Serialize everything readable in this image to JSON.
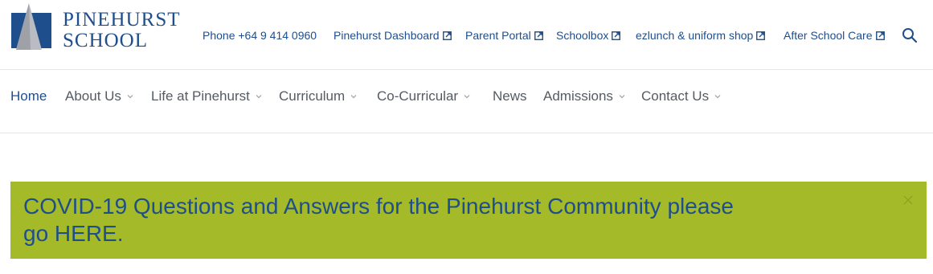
{
  "logo": {
    "line1": "PINEHURST",
    "line2": "SCHOOL"
  },
  "utility_links": [
    {
      "label": "Phone +64 9 414 0960",
      "external": false
    },
    {
      "label": "Pinehurst Dashboard",
      "external": true
    },
    {
      "label": "Parent Portal",
      "external": true
    },
    {
      "label": "Schoolbox",
      "external": true
    },
    {
      "label": "ezlunch & uniform shop",
      "external": true
    },
    {
      "label": "After School Care",
      "external": true
    }
  ],
  "nav": [
    {
      "label": "Home",
      "active": true,
      "dropdown": false
    },
    {
      "label": "About Us",
      "dropdown": true
    },
    {
      "label": "Life at Pinehurst",
      "dropdown": true
    },
    {
      "label": "Curriculum",
      "dropdown": true
    },
    {
      "label": "Co-Curricular",
      "dropdown": true
    },
    {
      "label": "News",
      "dropdown": false
    },
    {
      "label": "Admissions",
      "dropdown": true
    },
    {
      "label": "Contact Us",
      "dropdown": true
    }
  ],
  "banner": {
    "line1": "COVID-19 Questions and Answers for the Pinehurst Community please",
    "line2": "go HERE."
  },
  "colors": {
    "brand": "#1f4e8c",
    "banner": "#a4ba28",
    "nav_text": "#555b62"
  },
  "icons": {
    "search": "search-icon",
    "external": "external-link-icon",
    "close": "close-icon",
    "chevron": "chevron-down-icon"
  }
}
